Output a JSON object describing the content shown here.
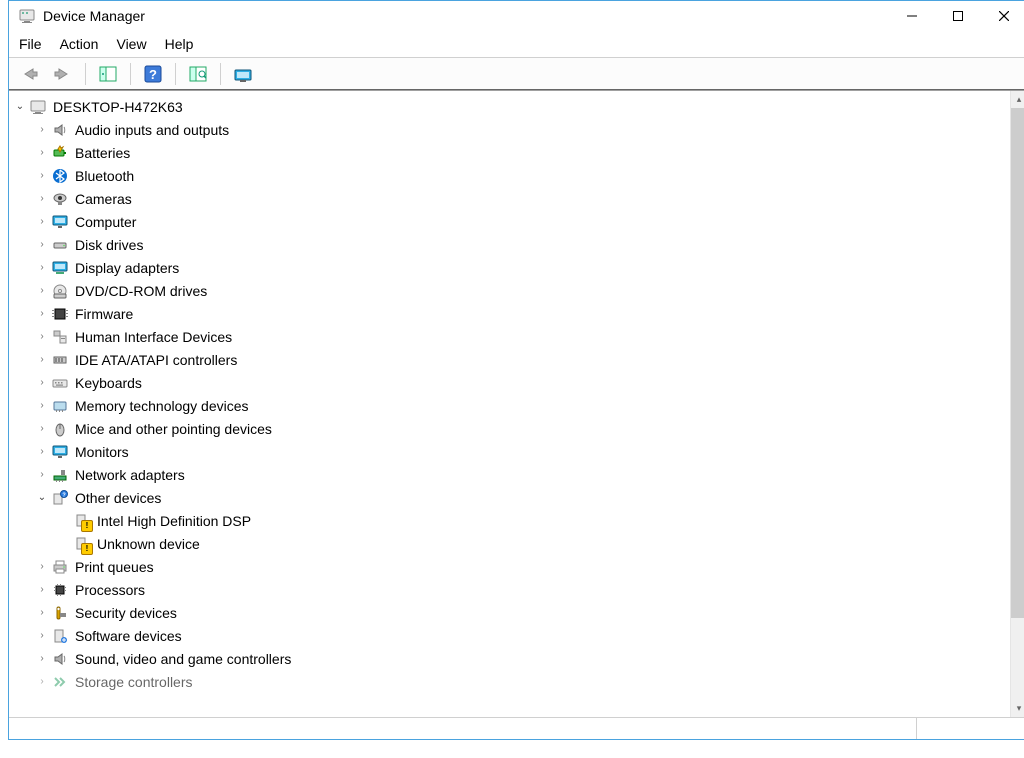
{
  "title": "Device Manager",
  "menus": {
    "file": "File",
    "action": "Action",
    "view": "View",
    "help": "Help"
  },
  "tree": {
    "root": "DESKTOP-H472K63",
    "categories": [
      {
        "label": "Audio inputs and outputs"
      },
      {
        "label": "Batteries"
      },
      {
        "label": "Bluetooth"
      },
      {
        "label": "Cameras"
      },
      {
        "label": "Computer"
      },
      {
        "label": "Disk drives"
      },
      {
        "label": "Display adapters"
      },
      {
        "label": "DVD/CD-ROM drives"
      },
      {
        "label": "Firmware"
      },
      {
        "label": "Human Interface Devices"
      },
      {
        "label": "IDE ATA/ATAPI controllers"
      },
      {
        "label": "Keyboards"
      },
      {
        "label": "Memory technology devices"
      },
      {
        "label": "Mice and other pointing devices"
      },
      {
        "label": "Monitors"
      },
      {
        "label": "Network adapters"
      },
      {
        "label": "Other devices",
        "expanded": true
      },
      {
        "label": "Print queues"
      },
      {
        "label": "Processors"
      },
      {
        "label": "Security devices"
      },
      {
        "label": "Software devices"
      },
      {
        "label": "Sound, video and game controllers"
      },
      {
        "label": "Storage controllers"
      }
    ],
    "other_devices_children": [
      {
        "label": "Intel High Definition DSP"
      },
      {
        "label": "Unknown device"
      }
    ]
  }
}
